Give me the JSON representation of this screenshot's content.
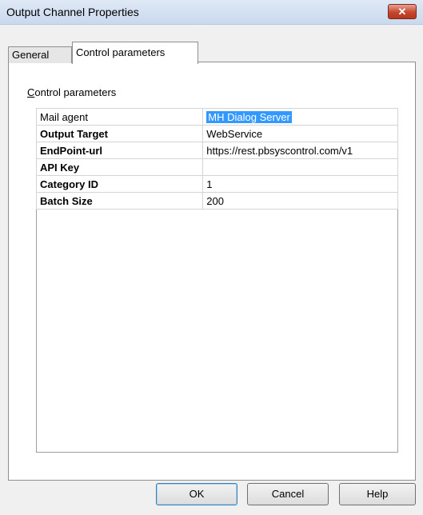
{
  "window": {
    "title": "Output Channel Properties",
    "close_glyph": "✕"
  },
  "tabs": [
    {
      "label": "General",
      "active": false
    },
    {
      "label": "Control parameters",
      "active": true
    }
  ],
  "group": {
    "label_first": "C",
    "label_rest": "ontrol parameters"
  },
  "properties": [
    {
      "name": "Mail agent",
      "value": "MH Dialog Server",
      "bold": false,
      "selected": true
    },
    {
      "name": "Output Target",
      "value": "WebService",
      "bold": true,
      "selected": false
    },
    {
      "name": "EndPoint-url",
      "value": "https://rest.pbsyscontrol.com/v1",
      "bold": true,
      "selected": false
    },
    {
      "name": "API Key",
      "value": "",
      "bold": true,
      "selected": false
    },
    {
      "name": "Category ID",
      "value": "1",
      "bold": true,
      "selected": false
    },
    {
      "name": "Batch Size",
      "value": "200",
      "bold": true,
      "selected": false
    }
  ],
  "buttons": {
    "ok": "OK",
    "cancel": "Cancel",
    "help": "Help"
  },
  "colors": {
    "selection": "#3399ff",
    "close_button": "#c4472e"
  }
}
